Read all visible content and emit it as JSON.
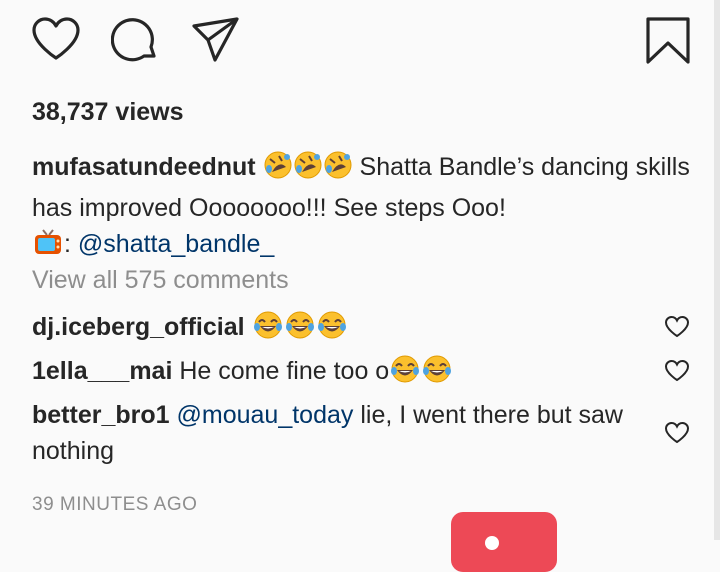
{
  "actions": {
    "like_icon": "heart-outline",
    "comment_icon": "speech-bubble",
    "share_icon": "paper-plane",
    "save_icon": "bookmark-outline"
  },
  "views": "38,737 views",
  "caption": {
    "username": "mufasatundeednut",
    "text": "Shatta Bandle’s dancing skills has improved Oooooooo!!! See steps Ooo!",
    "tv_suffix": ": ",
    "mention": "@shatta_bandle_"
  },
  "view_all_comments": "View all 575 comments",
  "comments": [
    {
      "username": "dj.iceberg_official",
      "text": ""
    },
    {
      "username": "1ella___mai",
      "text": "He come fine too o"
    },
    {
      "username": "better_bro1",
      "mention": "@mouau_today",
      "text": " lie, I went there but saw nothing"
    }
  ],
  "timestamp": "39 MINUTES AGO",
  "colors": {
    "background": "#fafafa",
    "text": "#262626",
    "muted": "#8e8e8e",
    "mention": "#003569",
    "fab": "#ed4956"
  }
}
